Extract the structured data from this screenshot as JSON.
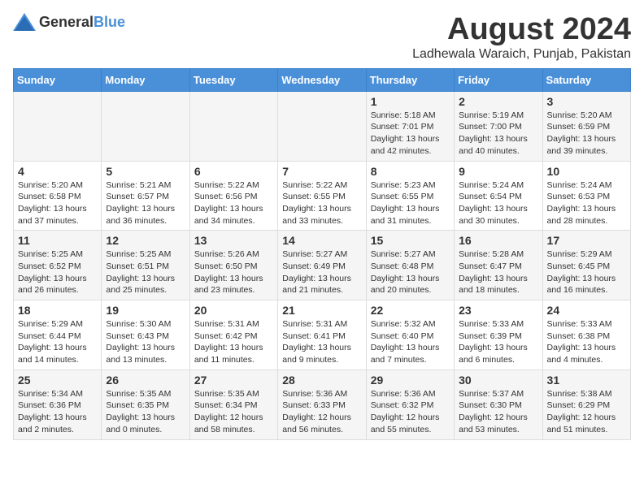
{
  "logo": {
    "general": "General",
    "blue": "Blue"
  },
  "title": "August 2024",
  "location": "Ladhewala Waraich, Punjab, Pakistan",
  "weekdays": [
    "Sunday",
    "Monday",
    "Tuesday",
    "Wednesday",
    "Thursday",
    "Friday",
    "Saturday"
  ],
  "weeks": [
    [
      {
        "day": "",
        "info": ""
      },
      {
        "day": "",
        "info": ""
      },
      {
        "day": "",
        "info": ""
      },
      {
        "day": "",
        "info": ""
      },
      {
        "day": "1",
        "info": "Sunrise: 5:18 AM\nSunset: 7:01 PM\nDaylight: 13 hours\nand 42 minutes."
      },
      {
        "day": "2",
        "info": "Sunrise: 5:19 AM\nSunset: 7:00 PM\nDaylight: 13 hours\nand 40 minutes."
      },
      {
        "day": "3",
        "info": "Sunrise: 5:20 AM\nSunset: 6:59 PM\nDaylight: 13 hours\nand 39 minutes."
      }
    ],
    [
      {
        "day": "4",
        "info": "Sunrise: 5:20 AM\nSunset: 6:58 PM\nDaylight: 13 hours\nand 37 minutes."
      },
      {
        "day": "5",
        "info": "Sunrise: 5:21 AM\nSunset: 6:57 PM\nDaylight: 13 hours\nand 36 minutes."
      },
      {
        "day": "6",
        "info": "Sunrise: 5:22 AM\nSunset: 6:56 PM\nDaylight: 13 hours\nand 34 minutes."
      },
      {
        "day": "7",
        "info": "Sunrise: 5:22 AM\nSunset: 6:55 PM\nDaylight: 13 hours\nand 33 minutes."
      },
      {
        "day": "8",
        "info": "Sunrise: 5:23 AM\nSunset: 6:55 PM\nDaylight: 13 hours\nand 31 minutes."
      },
      {
        "day": "9",
        "info": "Sunrise: 5:24 AM\nSunset: 6:54 PM\nDaylight: 13 hours\nand 30 minutes."
      },
      {
        "day": "10",
        "info": "Sunrise: 5:24 AM\nSunset: 6:53 PM\nDaylight: 13 hours\nand 28 minutes."
      }
    ],
    [
      {
        "day": "11",
        "info": "Sunrise: 5:25 AM\nSunset: 6:52 PM\nDaylight: 13 hours\nand 26 minutes."
      },
      {
        "day": "12",
        "info": "Sunrise: 5:25 AM\nSunset: 6:51 PM\nDaylight: 13 hours\nand 25 minutes."
      },
      {
        "day": "13",
        "info": "Sunrise: 5:26 AM\nSunset: 6:50 PM\nDaylight: 13 hours\nand 23 minutes."
      },
      {
        "day": "14",
        "info": "Sunrise: 5:27 AM\nSunset: 6:49 PM\nDaylight: 13 hours\nand 21 minutes."
      },
      {
        "day": "15",
        "info": "Sunrise: 5:27 AM\nSunset: 6:48 PM\nDaylight: 13 hours\nand 20 minutes."
      },
      {
        "day": "16",
        "info": "Sunrise: 5:28 AM\nSunset: 6:47 PM\nDaylight: 13 hours\nand 18 minutes."
      },
      {
        "day": "17",
        "info": "Sunrise: 5:29 AM\nSunset: 6:45 PM\nDaylight: 13 hours\nand 16 minutes."
      }
    ],
    [
      {
        "day": "18",
        "info": "Sunrise: 5:29 AM\nSunset: 6:44 PM\nDaylight: 13 hours\nand 14 minutes."
      },
      {
        "day": "19",
        "info": "Sunrise: 5:30 AM\nSunset: 6:43 PM\nDaylight: 13 hours\nand 13 minutes."
      },
      {
        "day": "20",
        "info": "Sunrise: 5:31 AM\nSunset: 6:42 PM\nDaylight: 13 hours\nand 11 minutes."
      },
      {
        "day": "21",
        "info": "Sunrise: 5:31 AM\nSunset: 6:41 PM\nDaylight: 13 hours\nand 9 minutes."
      },
      {
        "day": "22",
        "info": "Sunrise: 5:32 AM\nSunset: 6:40 PM\nDaylight: 13 hours\nand 7 minutes."
      },
      {
        "day": "23",
        "info": "Sunrise: 5:33 AM\nSunset: 6:39 PM\nDaylight: 13 hours\nand 6 minutes."
      },
      {
        "day": "24",
        "info": "Sunrise: 5:33 AM\nSunset: 6:38 PM\nDaylight: 13 hours\nand 4 minutes."
      }
    ],
    [
      {
        "day": "25",
        "info": "Sunrise: 5:34 AM\nSunset: 6:36 PM\nDaylight: 13 hours\nand 2 minutes."
      },
      {
        "day": "26",
        "info": "Sunrise: 5:35 AM\nSunset: 6:35 PM\nDaylight: 13 hours\nand 0 minutes."
      },
      {
        "day": "27",
        "info": "Sunrise: 5:35 AM\nSunset: 6:34 PM\nDaylight: 12 hours\nand 58 minutes."
      },
      {
        "day": "28",
        "info": "Sunrise: 5:36 AM\nSunset: 6:33 PM\nDaylight: 12 hours\nand 56 minutes."
      },
      {
        "day": "29",
        "info": "Sunrise: 5:36 AM\nSunset: 6:32 PM\nDaylight: 12 hours\nand 55 minutes."
      },
      {
        "day": "30",
        "info": "Sunrise: 5:37 AM\nSunset: 6:30 PM\nDaylight: 12 hours\nand 53 minutes."
      },
      {
        "day": "31",
        "info": "Sunrise: 5:38 AM\nSunset: 6:29 PM\nDaylight: 12 hours\nand 51 minutes."
      }
    ]
  ]
}
